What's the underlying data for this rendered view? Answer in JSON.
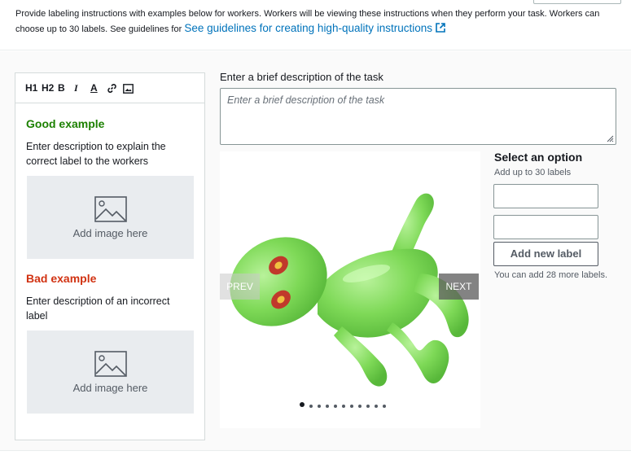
{
  "instructions": {
    "text": "Provide labeling instructions with examples below for workers. Workers will be viewing these instructions when they perform your task. Workers can choose up to 30 labels. See guidelines for",
    "link_text": "See guidelines for creating high-quality instructions",
    "link_icon": "external-link-icon"
  },
  "editor": {
    "toolbar": {
      "h1": "H1",
      "h2": "H2",
      "bold": "B",
      "italic": "I",
      "font_color": "A",
      "link_icon": "link-icon",
      "image_icon": "image-icon"
    },
    "good_example": {
      "title": "Good example",
      "description": "Enter description to explain the correct label to the workers",
      "image_label": "Add image here"
    },
    "bad_example": {
      "title": "Bad example",
      "description": "Enter description of an incorrect label",
      "image_label": "Add image here"
    }
  },
  "task_description": {
    "label": "Enter a brief description of the task",
    "placeholder": "Enter a brief description of the task"
  },
  "carousel": {
    "prev_label": "PREV",
    "next_label": "NEXT",
    "image_alt": "Green toy alien figure",
    "total_slides": 11,
    "active_slide": 1
  },
  "options": {
    "title": "Select an option",
    "subtitle": "Add up to 30 labels",
    "label_values": [
      "",
      ""
    ],
    "add_button": "Add new label",
    "remaining_note": "You can add 28 more labels."
  },
  "colors": {
    "good": "#1d8102",
    "bad": "#d13212",
    "link": "#0073bb",
    "alien_green": "#7ed957"
  }
}
